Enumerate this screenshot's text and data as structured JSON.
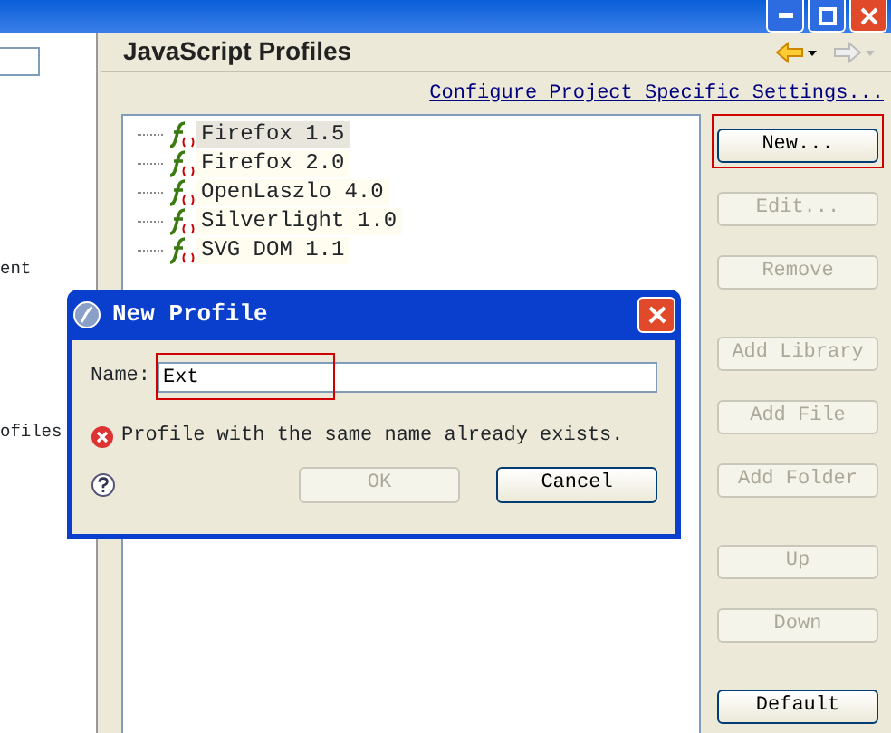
{
  "left_pane": {
    "fragments": [
      "ent",
      "ofiles"
    ]
  },
  "page": {
    "title": "JavaScript Profiles",
    "link": "Configure Project Specific Settings..."
  },
  "profiles": [
    {
      "label": "Firefox 1.5",
      "selected": true
    },
    {
      "label": "Firefox 2.0",
      "selected": false
    },
    {
      "label": "OpenLaszlo 4.0",
      "selected": false
    },
    {
      "label": "Silverlight 1.0",
      "selected": false
    },
    {
      "label": "SVG DOM 1.1",
      "selected": false
    }
  ],
  "buttons": [
    {
      "label": "New...",
      "disabled": false,
      "highlighted": true,
      "group_start": false
    },
    {
      "label": "Edit...",
      "disabled": true,
      "highlighted": false,
      "group_start": false
    },
    {
      "label": "Remove",
      "disabled": true,
      "highlighted": false,
      "group_start": false
    },
    {
      "label": "Add Library",
      "disabled": true,
      "highlighted": false,
      "group_start": true
    },
    {
      "label": "Add File",
      "disabled": true,
      "highlighted": false,
      "group_start": false
    },
    {
      "label": "Add Folder",
      "disabled": true,
      "highlighted": false,
      "group_start": false
    },
    {
      "label": "Up",
      "disabled": true,
      "highlighted": false,
      "group_start": true
    },
    {
      "label": "Down",
      "disabled": true,
      "highlighted": false,
      "group_start": false
    },
    {
      "label": "Default",
      "disabled": false,
      "highlighted": false,
      "group_start": true
    }
  ],
  "dialog": {
    "title": "New Profile",
    "name_label": "Name:",
    "name_value": "Ext",
    "name_highlighted": true,
    "error": "Profile with the same name already exists.",
    "buttons": [
      {
        "label": "OK",
        "disabled": true
      },
      {
        "label": "Cancel",
        "disabled": false
      }
    ]
  }
}
